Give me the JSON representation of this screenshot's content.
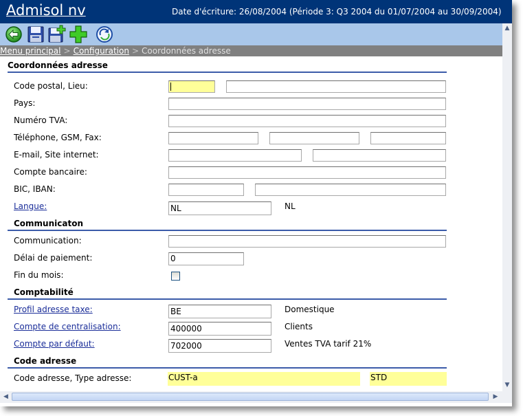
{
  "window": {
    "app_title": "Admisol nv",
    "write_date": "Date d'écriture: 26/08/2004 (Période 3: Q3 2004 du 01/07/2004 au 30/09/2004)"
  },
  "toolbar": {
    "icons": [
      "back-arrow-icon",
      "save-icon",
      "save-new-icon",
      "add-icon",
      "refresh-icon"
    ]
  },
  "breadcrumb": {
    "items": [
      "Menu principal",
      "Configuration",
      "Coordonnées adresse"
    ]
  },
  "sections": {
    "address": {
      "title": "Coordonnées adresse",
      "postal_label": "Code postal, Lieu:",
      "postal_code": "",
      "city": "",
      "country_label": "Pays:",
      "country": "",
      "vat_label": "Numéro TVA:",
      "vat": "",
      "phone_label": "Téléphone, GSM, Fax:",
      "phone": "",
      "mobile": "",
      "fax": "",
      "email_label": "E-mail, Site internet:",
      "email": "",
      "website": "",
      "bank_label": "Compte bancaire:",
      "bank": "",
      "bic_label": "BIC, IBAN:",
      "bic": "",
      "iban": "",
      "lang_label": "Langue:",
      "lang_value": "NL",
      "lang_desc": "NL"
    },
    "communication": {
      "title": "Communicaton",
      "comm_label": "Communication:",
      "comm_value": "",
      "delay_label": "Délai de paiement:",
      "delay_value": "0",
      "eom_label": "Fin du mois:",
      "eom_checked": false
    },
    "accounting": {
      "title": "Comptabilité",
      "tax_label": "Profil adresse taxe:",
      "tax_value": "BE",
      "tax_desc": "Domestique",
      "central_label": "Compte de centralisation:",
      "central_value": "400000",
      "central_desc": "Clients",
      "default_label": "Compte par défaut:",
      "default_value": "702000",
      "default_desc": "Ventes TVA tarif 21%"
    },
    "code": {
      "title": "Code adresse",
      "code_label": "Code adresse, Type adresse:",
      "code_value": "CUST-a",
      "type_value": "STD"
    }
  },
  "colors": {
    "titlebar": "#003478",
    "toolbar": "#a9c7ea",
    "breadcrumb_bg": "#808080",
    "section_line": "#3b5ba9",
    "highlight": "#ffff99",
    "link": "#1a2d99"
  }
}
